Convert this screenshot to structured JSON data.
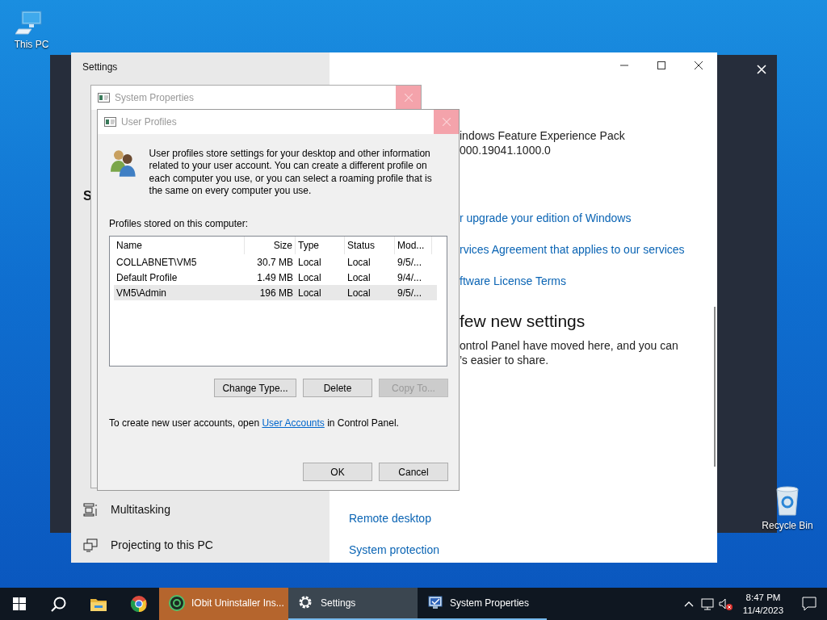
{
  "desktop_icons": [
    {
      "label": "This PC",
      "kind": "computer"
    },
    {
      "label": "Recycle Bin",
      "kind": "recycle"
    }
  ],
  "settings_window": {
    "title": "Settings",
    "sidebar_heading": "S",
    "sidebar_items": [
      {
        "label": "Multitasking",
        "kind": "multitask"
      },
      {
        "label": "Projecting to this PC",
        "kind": "project"
      }
    ],
    "content": [
      {
        "kind": "text",
        "text": "indows Feature Experience Pack"
      },
      {
        "kind": "text",
        "text": "000.19041.1000.0"
      },
      {
        "kind": "link",
        "text": "r upgrade your edition of Windows"
      },
      {
        "kind": "link",
        "text": "rvices Agreement that applies to our services"
      },
      {
        "kind": "link",
        "text": "ftware License Terms"
      },
      {
        "kind": "heading",
        "text": "few new settings"
      },
      {
        "kind": "text",
        "text": "ontrol Panel have moved here, and you can"
      },
      {
        "kind": "text",
        "text": "’s easier to share."
      }
    ],
    "related_links": [
      "Remote desktop",
      "System protection"
    ]
  },
  "system_properties": {
    "title": "System Properties",
    "active": false
  },
  "user_profiles": {
    "title": "User Profiles",
    "active": false,
    "intro": "User profiles store settings for your desktop and other information related to your user account. You can create a different profile on each computer you use, or you can select a roaming profile that is the same on every computer you use.",
    "list_label": "Profiles stored on this computer:",
    "columns": [
      "Name",
      "Size",
      "Type",
      "Status",
      "Mod..."
    ],
    "rows": [
      {
        "cells": [
          "COLLABNET\\VM5",
          "30.7 MB",
          "Local",
          "Local",
          "9/5/..."
        ],
        "selected": false
      },
      {
        "cells": [
          "Default Profile",
          "1.49 MB",
          "Local",
          "Local",
          "9/4/..."
        ],
        "selected": false
      },
      {
        "cells": [
          "VM5\\Admin",
          "196 MB",
          "Local",
          "Local",
          "9/5/..."
        ],
        "selected": true
      }
    ],
    "actions": [
      {
        "label": "Change Type...",
        "disabled": false
      },
      {
        "label": "Delete",
        "disabled": false
      },
      {
        "label": "Copy To...",
        "disabled": true
      }
    ],
    "footer": {
      "before": "To create new user accounts, open ",
      "link": "User Accounts",
      "after": " in Control Panel."
    },
    "buttons": [
      {
        "label": "OK",
        "disabled": false
      },
      {
        "label": "Cancel",
        "disabled": false
      }
    ]
  },
  "taskbar": {
    "apps": [
      {
        "label": "IObit Uninstaller Ins...",
        "kind": "iobit",
        "attention": true,
        "selected": false
      },
      {
        "label": "Settings",
        "kind": "settings",
        "attention": false,
        "selected": true
      },
      {
        "label": "System Properties",
        "kind": "sysprops",
        "attention": false,
        "selected": false
      }
    ],
    "time": "8:47 PM",
    "date": "11/4/2023"
  }
}
